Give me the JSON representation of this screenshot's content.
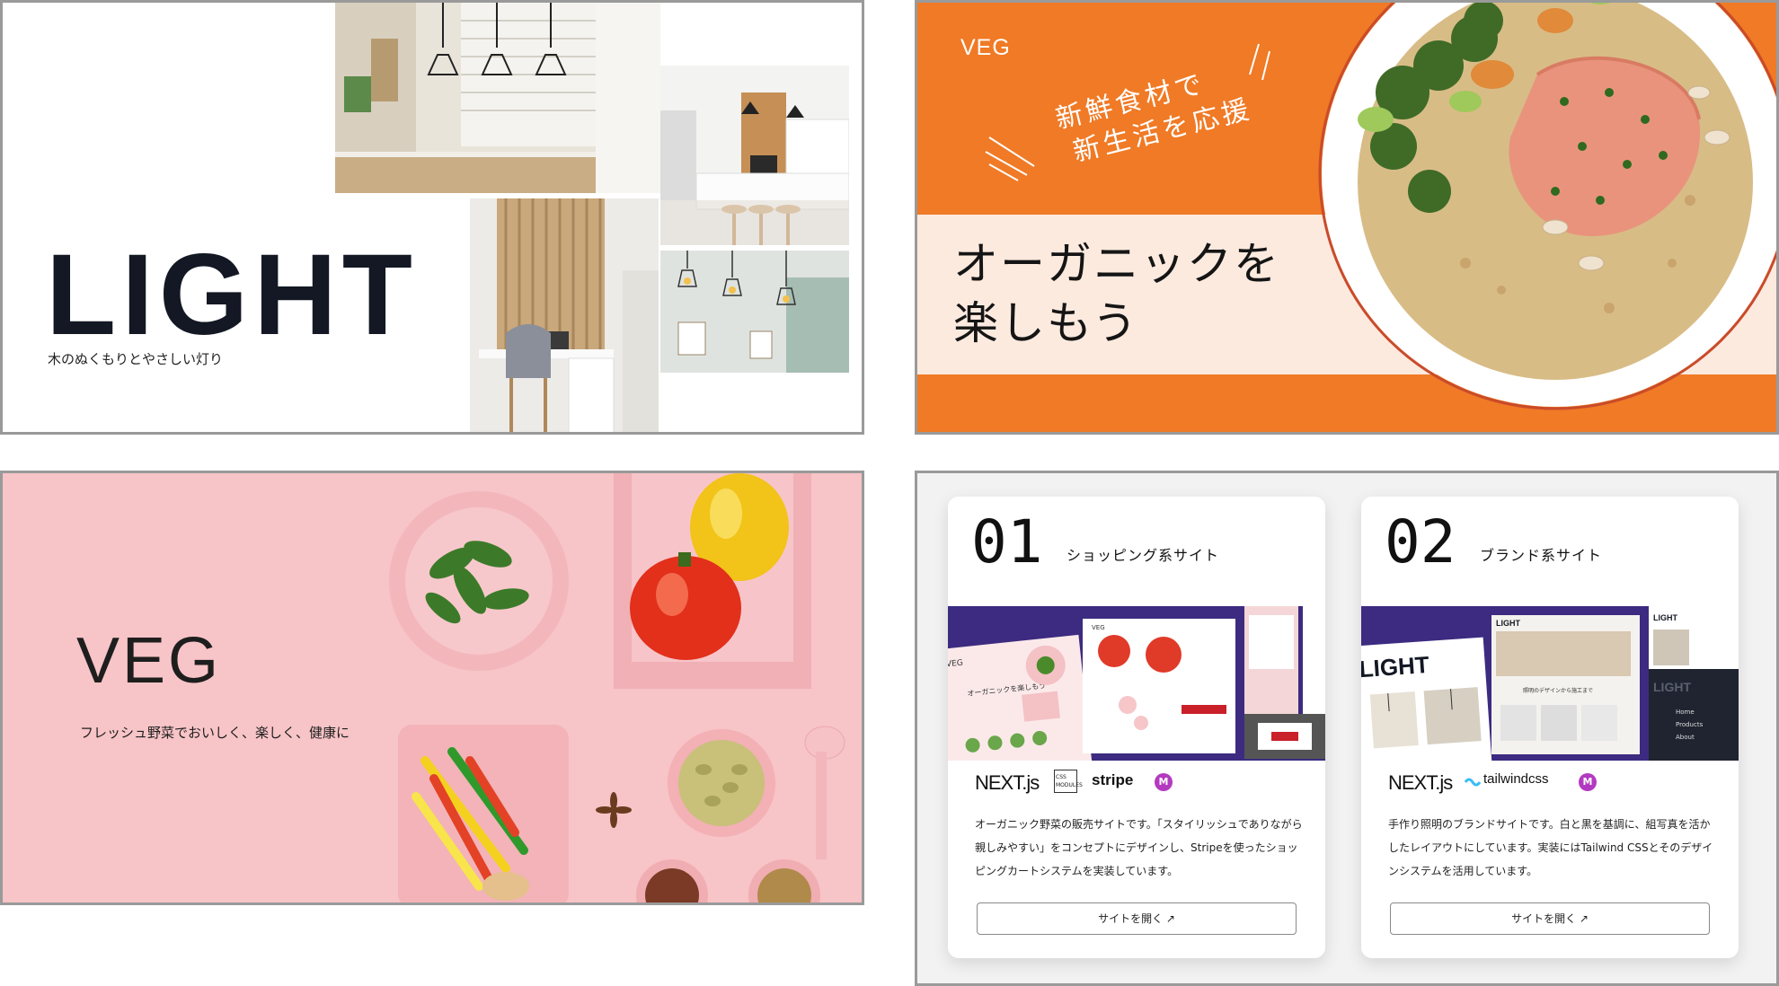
{
  "light": {
    "title": "LIGHT",
    "subtitle": "木のぬくもりとやさしい灯り"
  },
  "veg_orange": {
    "brand": "VEG",
    "slogan_line1": "新鮮食材で",
    "slogan_line2": "新生活を応援",
    "heading_line1": "オーガニックを",
    "heading_line2": "楽しもう",
    "accent": "#f07a25"
  },
  "veg_pink": {
    "brand": "VEG",
    "subtitle": "フレッシュ野菜でおいしく、楽しく、健康に",
    "accent": "#f7c4c7"
  },
  "cards": [
    {
      "number": "01",
      "title": "ショッピング系サイト",
      "logos": [
        "NEXT.js",
        "CSS MODULES",
        "stripe",
        "M"
      ],
      "description": "オーガニック野菜の販売サイトです。「スタイリッシュでありながら親しみやすい」をコンセプトにデザインし、Stripeを使ったショッピングカートシステムを実装しています。",
      "button": "サイトを開く ↗",
      "preview": {
        "veg_brand": "VEG",
        "veg_heading": "オーガニックを楽しもう"
      }
    },
    {
      "number": "02",
      "title": "ブランド系サイト",
      "logos": [
        "NEXT.js",
        "tailwindcss",
        "M"
      ],
      "description": "手作り照明のブランドサイトです。白と黒を基調に、組写真を活かしたレイアウトにしています。実装にはTailwind CSSとそのデザインシステムを活用しています。",
      "button": "サイトを開く ↗",
      "preview": {
        "light_title": "LIGHT",
        "light_heading": "照明のデザインから施工まで",
        "menu": [
          "Home",
          "Products",
          "About"
        ]
      }
    }
  ]
}
